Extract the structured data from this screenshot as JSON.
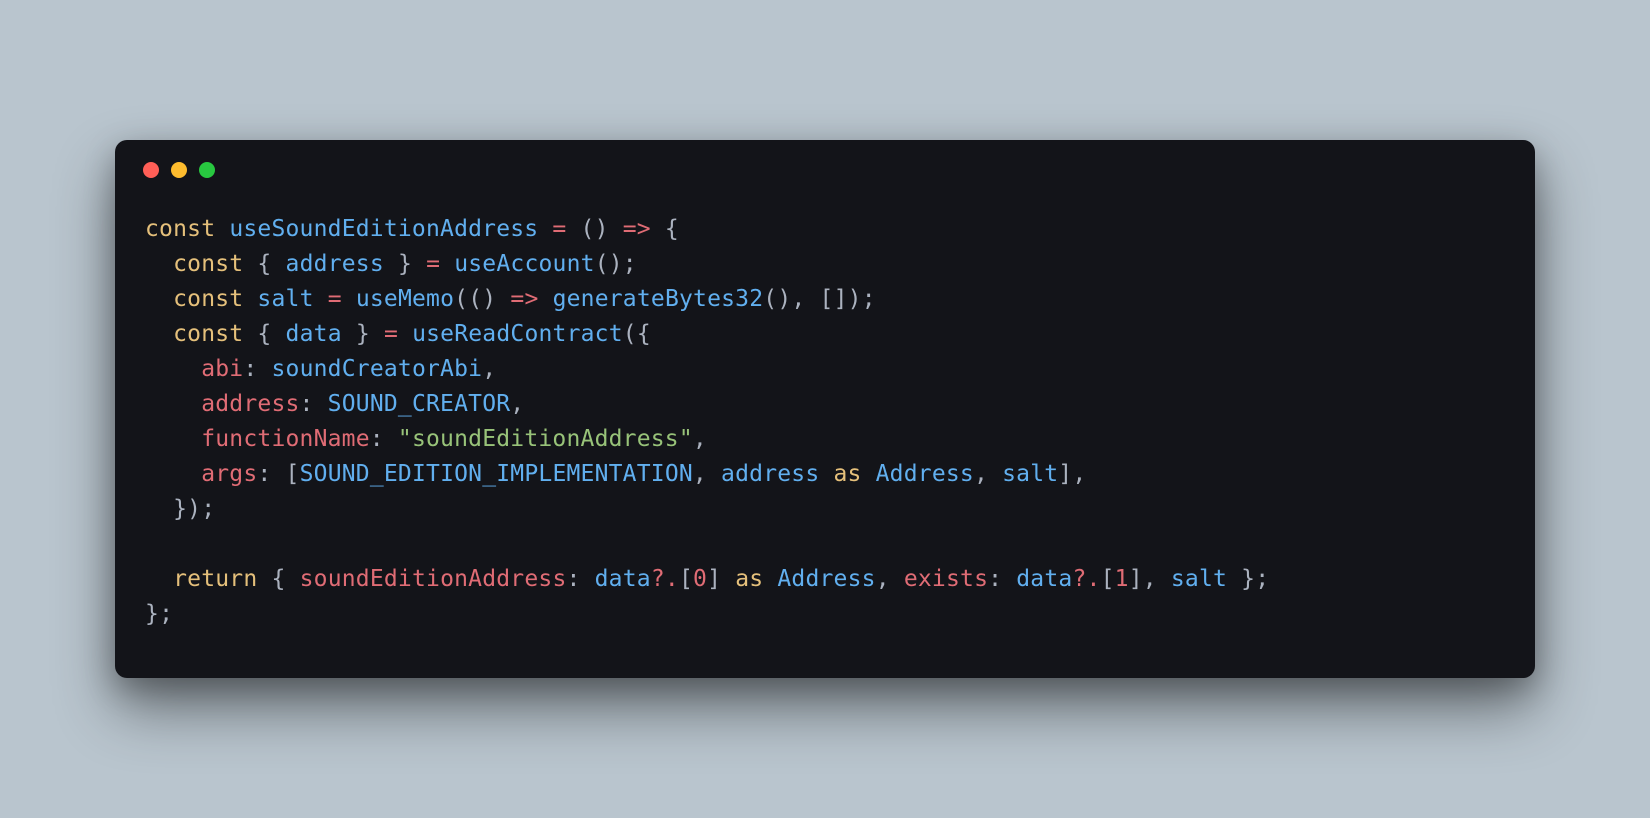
{
  "colors": {
    "bg": "#b9c5ce",
    "window": "#131419",
    "red": "#ff5f57",
    "yellow": "#febc2e",
    "green": "#28c840",
    "keyword": "#e5c07b",
    "declaration": "#61afef",
    "punctuation": "#abb2bf",
    "operator": "#e06c75",
    "propkey": "#e06c75",
    "value": "#61afef",
    "string": "#98c379",
    "number": "#e06c75"
  },
  "code": {
    "kw_const": "const",
    "kw_return": "return",
    "kw_as": "as",
    "fn_name": "useSoundEditionAddress",
    "eq": "=",
    "arrow": "=>",
    "parens_empty": "()",
    "brace_open": "{",
    "brace_close": "}",
    "semi": ";",
    "comma": ",",
    "paren_open": "(",
    "paren_close": ")",
    "bracket_open": "[",
    "bracket_close": "]",
    "colon": ":",
    "opt_chain": "?.",
    "destr_address": "address",
    "useAccount": "useAccount",
    "salt": "salt",
    "useMemo": "useMemo",
    "generateBytes32": "generateBytes32",
    "empty_array": "[]",
    "destr_data": "data",
    "useReadContract": "useReadContract",
    "key_abi": "abi",
    "val_soundCreatorAbi": "soundCreatorAbi",
    "key_address": "address",
    "val_SOUND_CREATOR": "SOUND_CREATOR",
    "key_functionName": "functionName",
    "str_soundEditionAddress": "\"soundEditionAddress\"",
    "key_args": "args",
    "val_SOUND_EDITION_IMPLEMENTATION": "SOUND_EDITION_IMPLEMENTATION",
    "val_address": "address",
    "type_Address": "Address",
    "key_soundEditionAddress": "soundEditionAddress",
    "val_data": "data",
    "idx0": "0",
    "idx1": "1",
    "key_exists": "exists"
  }
}
